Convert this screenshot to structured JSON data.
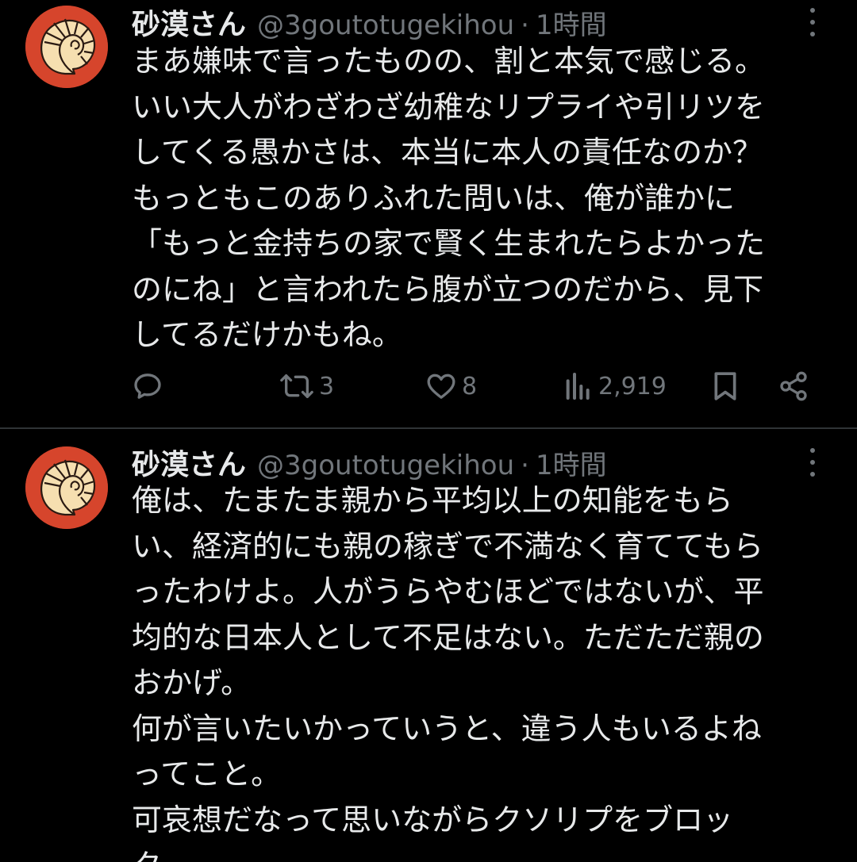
{
  "tweets": [
    {
      "display_name": "砂漠さん",
      "handle": "@3goutotugekihou",
      "separator": "·",
      "time": "1時間",
      "lines": [
        "まあ嫌味で言ったものの、割と本気で感じる。",
        "いい大人がわざわざ幼稚なリプライや引リツを",
        "してくる愚かさは、本当に本人の責任なのか？",
        "もっともこのありふれた問いは、俺が誰かに",
        "「もっと金持ちの家で賢く生まれたらよかった",
        "のにね」と言われたら腹が立つのだから、見下",
        "してるだけかもね。"
      ],
      "actions": {
        "retweets": "3",
        "likes": "8",
        "views": "2,919"
      }
    },
    {
      "display_name": "砂漠さん",
      "handle": "@3goutotugekihou",
      "separator": "·",
      "time": "1時間",
      "lines": [
        "俺は、たまたま親から平均以上の知能をもら",
        "い、経済的にも親の稼ぎで不満なく育ててもら",
        "ったわけよ。人がうらやむほどではないが、平",
        "均的な日本人として不足はない。ただただ親の",
        "おかげ。",
        "何が言いたいかっていうと、違う人もいるよね",
        "ってこと。",
        "可哀想だなって思いながらクソリプをブロッ",
        "ク。"
      ]
    }
  ],
  "colors": {
    "background": "#000000",
    "text": "#e7e9ea",
    "secondary": "#71767b",
    "divider": "#2f3336",
    "avatar_bg": "#d6452c",
    "avatar_shell": "#f6dfb0"
  },
  "icons": {
    "avatar": "ammonite-shell-icon",
    "more": "more-vertical-icon",
    "reply": "reply-icon",
    "retweet": "retweet-icon",
    "like": "heart-icon",
    "views": "views-bar-chart-icon",
    "bookmark": "bookmark-icon",
    "share": "share-icon"
  }
}
